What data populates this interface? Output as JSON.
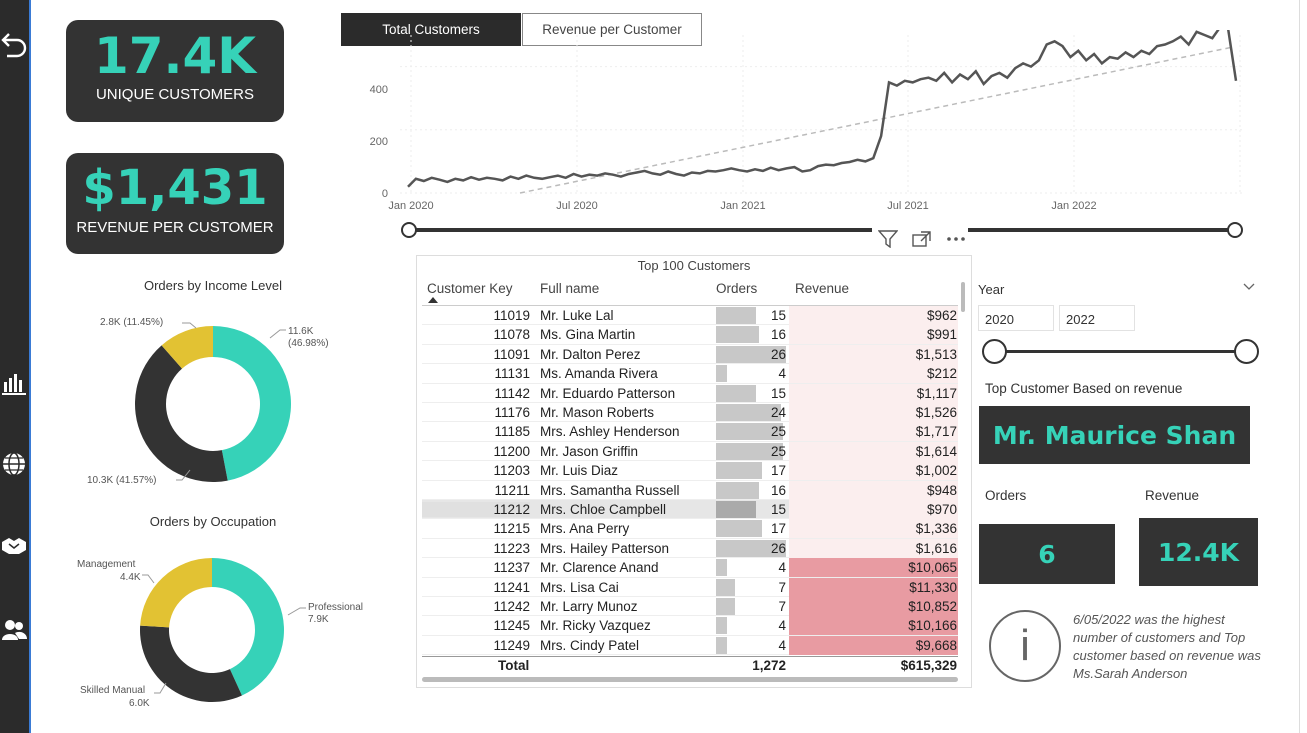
{
  "kpis": {
    "unique_customers_value": "17.4K",
    "unique_customers_label": "UNIQUE CUSTOMERS",
    "revenue_per_customer_value": "$1,431",
    "revenue_per_customer_label": "REVENUE PER CUSTOMER"
  },
  "tabs": [
    {
      "label": "Total Customers",
      "active": true
    },
    {
      "label": "Revenue per Customer",
      "active": false
    }
  ],
  "line_chart": {
    "y_ticks": [
      "400",
      "200",
      "0"
    ],
    "x_ticks": [
      "Jan 2020",
      "Jul 2020",
      "Jan 2021",
      "Jul 2021",
      "Jan 2022"
    ]
  },
  "donut_income": {
    "title": "Orders by Income Level",
    "labels": [
      "2.8K (11.45%)",
      "11.6K",
      "(46.98%)",
      "10.3K (41.57%)"
    ]
  },
  "donut_occupation": {
    "title": "Orders by Occupation",
    "labels": [
      "Management",
      "4.4K",
      "Professional",
      "7.9K",
      "Skilled Manual",
      "6.0K"
    ]
  },
  "table": {
    "title": "Top 100 Customers",
    "headers": [
      "Customer Key",
      "Full name",
      "Orders",
      "Revenue"
    ],
    "rows": [
      {
        "key": "11019",
        "name": "Mr. Luke Lal",
        "orders": "15",
        "revenue": "$962"
      },
      {
        "key": "11078",
        "name": "Ms. Gina Martin",
        "orders": "16",
        "revenue": "$991"
      },
      {
        "key": "11091",
        "name": "Mr. Dalton Perez",
        "orders": "26",
        "revenue": "$1,513"
      },
      {
        "key": "11131",
        "name": "Ms. Amanda Rivera",
        "orders": "4",
        "revenue": "$212"
      },
      {
        "key": "11142",
        "name": "Mr. Eduardo Patterson",
        "orders": "15",
        "revenue": "$1,117"
      },
      {
        "key": "11176",
        "name": "Mr. Mason Roberts",
        "orders": "24",
        "revenue": "$1,526"
      },
      {
        "key": "11185",
        "name": "Mrs. Ashley Henderson",
        "orders": "25",
        "revenue": "$1,717"
      },
      {
        "key": "11200",
        "name": "Mr. Jason Griffin",
        "orders": "25",
        "revenue": "$1,614"
      },
      {
        "key": "11203",
        "name": "Mr. Luis Diaz",
        "orders": "17",
        "revenue": "$1,002"
      },
      {
        "key": "11211",
        "name": "Mrs. Samantha Russell",
        "orders": "16",
        "revenue": "$948"
      },
      {
        "key": "11212",
        "name": "Mrs. Chloe Campbell",
        "orders": "15",
        "revenue": "$970"
      },
      {
        "key": "11215",
        "name": "Mrs. Ana Perry",
        "orders": "17",
        "revenue": "$1,336"
      },
      {
        "key": "11223",
        "name": "Mrs. Hailey Patterson",
        "orders": "26",
        "revenue": "$1,616"
      },
      {
        "key": "11237",
        "name": "Mr. Clarence Anand",
        "orders": "4",
        "revenue": "$10,065"
      },
      {
        "key": "11241",
        "name": "Mrs. Lisa Cai",
        "orders": "7",
        "revenue": "$11,330"
      },
      {
        "key": "11242",
        "name": "Mr. Larry Munoz",
        "orders": "7",
        "revenue": "$10,852"
      },
      {
        "key": "11245",
        "name": "Mr. Ricky Vazquez",
        "orders": "4",
        "revenue": "$10,166"
      },
      {
        "key": "11249",
        "name": "Mrs. Cindy Patel",
        "orders": "4",
        "revenue": "$9,668"
      }
    ],
    "total_label": "Total",
    "total_orders": "1,272",
    "total_revenue": "$615,329"
  },
  "filters": {
    "year_label": "Year",
    "year_from": "2020",
    "year_to": "2022"
  },
  "top_customer": {
    "label": "Top Customer Based on revenue",
    "name": "Mr. Maurice Shan",
    "orders_label": "Orders",
    "orders_value": "6",
    "revenue_label": "Revenue",
    "revenue_value": "12.4K"
  },
  "info": {
    "icon_text": "i",
    "note": "6/05/2022 was the highest number of customers and Top customer based on revenue was Ms.Sarah Anderson"
  },
  "colors": {
    "accent": "#36d2b8",
    "dark": "#333333",
    "yellow": "#e2c233",
    "revenue_light": "#fbeeee",
    "revenue_high": "#e89ba2"
  },
  "chart_data": [
    {
      "type": "line",
      "title": "",
      "xlabel": "",
      "ylabel": "",
      "x_ticks": [
        "Jan 2020",
        "Jul 2020",
        "Jan 2021",
        "Jul 2021",
        "Jan 2022"
      ],
      "ylim": [
        0,
        500
      ],
      "grid": true,
      "series": [
        {
          "values": [
            20,
            45,
            38,
            48,
            42,
            35,
            45,
            40,
            50,
            42,
            48,
            45,
            40,
            52,
            45,
            55,
            48,
            45,
            50,
            55,
            48,
            60,
            52,
            58,
            55,
            62,
            58,
            52,
            60,
            65,
            70,
            62,
            58,
            68,
            60,
            55,
            65,
            62,
            70,
            68,
            72,
            78,
            72,
            68,
            75,
            70,
            80,
            72,
            78,
            82,
            68,
            72,
            85,
            90,
            88,
            95,
            98,
            105,
            100,
            110,
            180,
            350,
            340,
            355,
            350,
            360,
            365,
            355,
            380,
            350,
            375,
            360,
            385,
            345,
            370,
            380,
            365,
            395,
            410,
            400,
            420,
            470,
            480,
            465,
            430,
            450,
            420,
            440,
            410,
            430,
            425,
            445,
            430,
            450,
            440,
            465,
            470,
            480,
            495,
            470,
            510,
            500,
            490,
            525,
            520,
            355
          ]
        },
        {
          "values": [
            0,
            460
          ]
        }
      ]
    },
    {
      "type": "pie",
      "title": "Orders by Income Level",
      "categories": [
        "11.6K",
        "10.3K",
        "2.8K"
      ],
      "values": [
        46.98,
        41.57,
        11.45
      ]
    },
    {
      "type": "pie",
      "title": "Orders by Occupation",
      "categories": [
        "Professional",
        "Skilled Manual",
        "Management"
      ],
      "values": [
        7.9,
        6.0,
        4.4
      ]
    }
  ]
}
